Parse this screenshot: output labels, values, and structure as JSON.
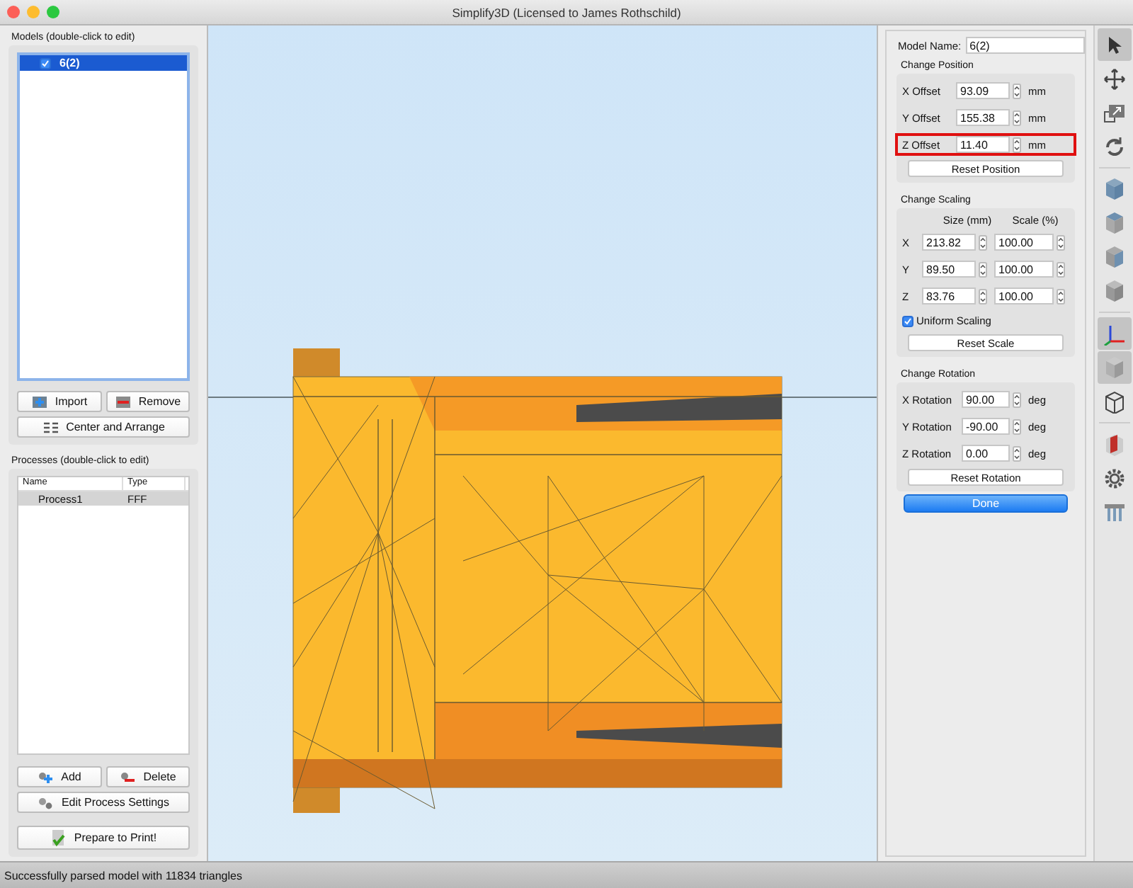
{
  "window": {
    "title": "Simplify3D (Licensed to James Rothschild)"
  },
  "models": {
    "label": "Models (double-click to edit)",
    "items": [
      {
        "name": "6(2)",
        "checked": true,
        "selected": true
      }
    ],
    "buttons": [
      {
        "kind": "import",
        "label": "Import"
      },
      {
        "kind": "remove",
        "label": "Remove"
      },
      {
        "kind": "arrange",
        "label": "Center and Arrange"
      }
    ]
  },
  "processes": {
    "label": "Processes (double-click to edit)",
    "columns": [
      "Name",
      "Type"
    ],
    "rows": [
      {
        "name": "Process1",
        "type": "FFF",
        "selected": true
      }
    ],
    "buttons": [
      {
        "kind": "add",
        "label": "Add"
      },
      {
        "kind": "delete",
        "label": "Delete"
      },
      {
        "kind": "settings",
        "label": "Edit Process Settings"
      }
    ],
    "prepare": "Prepare to Print!"
  },
  "properties": {
    "model_name_label": "Model Name:",
    "model_name": "6(2)",
    "position": {
      "title": "Change Position",
      "rows": [
        {
          "label": "X Offset",
          "value": "93.09",
          "unit": "mm",
          "highlighted": false
        },
        {
          "label": "Y Offset",
          "value": "155.38",
          "unit": "mm",
          "highlighted": false
        },
        {
          "label": "Z Offset",
          "value": "11.40",
          "unit": "mm",
          "highlighted": true
        }
      ],
      "button": "Reset Position"
    },
    "scaling": {
      "title": "Change Scaling",
      "size_header": "Size (mm)",
      "scale_header": "Scale (%)",
      "rows": [
        {
          "axis": "X",
          "size": "213.82",
          "scale": "100.00"
        },
        {
          "axis": "Y",
          "size": "89.50",
          "scale": "100.00"
        },
        {
          "axis": "Z",
          "size": "83.76",
          "scale": "100.00"
        }
      ],
      "uniform_label": "Uniform Scaling",
      "uniform_checked": true,
      "button": "Reset Scale"
    },
    "rotation": {
      "title": "Change Rotation",
      "rows": [
        {
          "label": "X Rotation",
          "value": "90.00",
          "unit": "deg"
        },
        {
          "label": "Y Rotation",
          "value": "-90.00",
          "unit": "deg"
        },
        {
          "label": "Z Rotation",
          "value": "0.00",
          "unit": "deg"
        }
      ],
      "button": "Reset Rotation"
    },
    "done": "Done"
  },
  "toolbar": [
    {
      "kind": "pointer",
      "selected": true
    },
    {
      "kind": "move",
      "selected": false
    },
    {
      "kind": "scale",
      "selected": false
    },
    {
      "kind": "rotate",
      "selected": false
    },
    {
      "kind": "cube-front",
      "selected": false
    },
    {
      "kind": "cube-top",
      "selected": false
    },
    {
      "kind": "cube-side",
      "selected": false
    },
    {
      "kind": "cube-iso",
      "selected": false
    },
    {
      "kind": "axes",
      "selected": true
    },
    {
      "kind": "solid",
      "selected": true
    },
    {
      "kind": "wireframe",
      "selected": false
    },
    {
      "kind": "section",
      "selected": false
    },
    {
      "kind": "gear",
      "selected": false
    },
    {
      "kind": "supports",
      "selected": false
    }
  ],
  "status_bar": "Successfully parsed model with 11834 triangles"
}
